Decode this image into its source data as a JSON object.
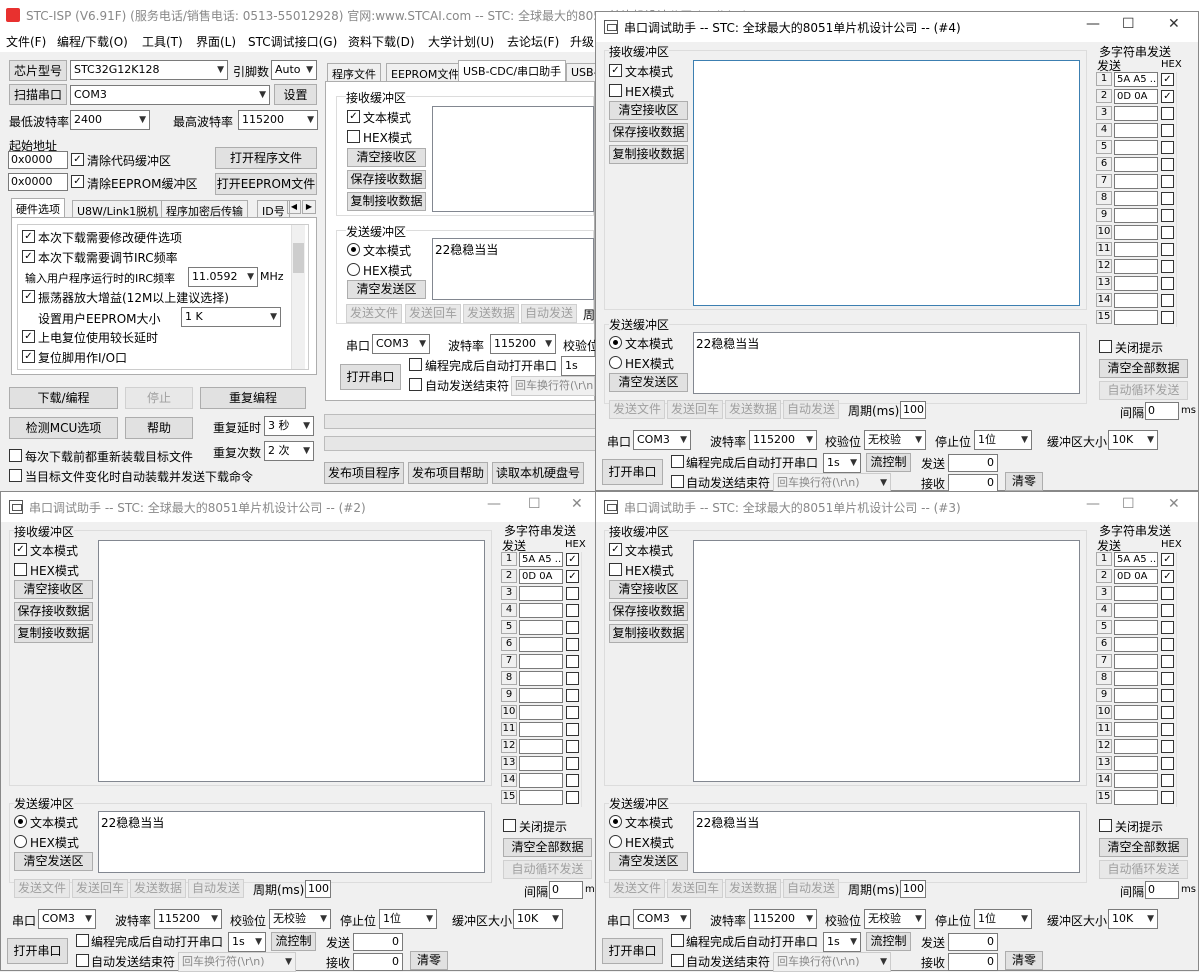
{
  "main": {
    "title": "STC-ISP (V6.91F) (服务电话/销售电话: 0513-55012928) 官网:www.STCAI.com  -- STC: 全球最大的8051单片机设计公司 (Build...)",
    "menu": [
      "文件(F)",
      "编程/下载(O)",
      "工具(T)",
      "界面(L)",
      "STC调试接口(G)",
      "资料下载(D)",
      "大学计划(U)",
      "去论坛(F)",
      "升级"
    ],
    "chip_label": "芯片型号",
    "chip": "STC32G12K128",
    "pins_label": "引脚数",
    "pins": "Auto",
    "scan_label": "扫描串口",
    "port": "COM3",
    "settings": "设置",
    "min_baud_label": "最低波特率",
    "min_baud": "2400",
    "max_baud_label": "最高波特率",
    "max_baud": "115200",
    "start_addr": "起始地址",
    "addr1": "0x0000",
    "addr2": "0x0000",
    "clear_code": "清除代码缓冲区",
    "clear_eeprom": "清除EEPROM缓冲区",
    "open_prog": "打开程序文件",
    "open_eeprom": "打开EEPROM文件",
    "hw_tabs": [
      "硬件选项",
      "U8W/Link1脱机",
      "程序加密后传输",
      "ID号"
    ],
    "opt1": "本次下载需要修改硬件选项",
    "opt2": "本次下载需要调节IRC频率",
    "irc_label": "输入用户程序运行时的IRC频率",
    "irc": "11.0592",
    "mhz": "MHz",
    "opt3": "振荡器放大增益(12M以上建议选择)",
    "eeprom_label": "设置用户EEPROM大小",
    "eeprom": "1   K",
    "opt4": "上电复位使用较长延时",
    "opt5": "复位脚用作I/O口",
    "download": "下载/编程",
    "stop": "停止",
    "reprogram": "重复编程",
    "check_mcu": "检测MCU选项",
    "help": "帮助",
    "repeat_delay_label": "重复延时",
    "repeat_delay": "3 秒",
    "repeat_count_label": "重复次数",
    "repeat_count": "2 次",
    "reload_each": "每次下载前都重新装载目标文件",
    "auto_reload": "当目标文件变化时自动装载并发送下载命令",
    "right_tabs": [
      "程序文件",
      "EEPROM文件",
      "USB-CDC/串口助手",
      "USB-"
    ],
    "rx_group": "接收缓冲区",
    "text_mode": "文本模式",
    "hex_mode": "HEX模式",
    "clear_rx": "清空接收区",
    "save_rx": "保存接收数据",
    "copy_rx": "复制接收数据",
    "tx_group": "发送缓冲区",
    "tx_text": "22稳稳当当",
    "clear_tx": "清空发送区",
    "send_file": "发送文件",
    "send_enter": "发送回车",
    "send_data": "发送数据",
    "auto_send": "自动发送",
    "period_short": "周",
    "port_label": "串口",
    "baud_label": "波特率",
    "baud": "115200",
    "parity_short": "校验位",
    "open_port": "打开串口",
    "auto_open": "编程完成后自动打开串口",
    "auto_open_time": "1s",
    "auto_end": "自动发送结束符",
    "newline": "回车换行符(\\r\\n)",
    "publish_prog": "发布项目程序",
    "publish_help": "发布项目帮助",
    "read_disk": "读取本机硬盘号"
  },
  "serial": {
    "title4": "串口调试助手 -- STC: 全球最大的8051单片机设计公司 -- (#4)",
    "title2": "串口调试助手 -- STC: 全球最大的8051单片机设计公司 -- (#2)",
    "title3": "串口调试助手 -- STC: 全球最大的8051单片机设计公司 -- (#3)",
    "rx_group": "接收缓冲区",
    "text_mode": "文本模式",
    "hex_mode": "HEX模式",
    "clear_rx": "清空接收区",
    "save_rx": "保存接收数据",
    "copy_rx": "复制接收数据",
    "multi_title": "多字符串发送",
    "send_col": "发送",
    "hex_col": "HEX",
    "row1": "5A A5 ...",
    "row2": "0D 0A",
    "rows": [
      "1",
      "2",
      "3",
      "4",
      "5",
      "6",
      "7",
      "8",
      "9",
      "10",
      "11",
      "12",
      "13",
      "14",
      "15"
    ],
    "tx_group": "发送缓冲区",
    "tx_text": "22稳稳当当",
    "clear_tx": "清空发送区",
    "close_hint": "关闭提示",
    "clear_all": "清空全部数据",
    "auto_loop": "自动循环发送",
    "interval_label": "间隔",
    "interval": "0",
    "ms": "ms",
    "send_file": "发送文件",
    "send_enter": "发送回车",
    "send_data": "发送数据",
    "auto_send": "自动发送",
    "period_label": "周期(ms)",
    "period": "100",
    "port_label": "串口",
    "port": "COM3",
    "baud_label": "波特率",
    "baud": "115200",
    "parity_label": "校验位",
    "parity": "无校验",
    "stop_label": "停止位",
    "stop": "1位",
    "bufsize_label": "缓冲区大小",
    "bufsize": "10K",
    "open_port": "打开串口",
    "auto_open": "编程完成后自动打开串口",
    "auto_open_time": "1s",
    "flow": "流控制",
    "auto_end": "自动发送结束符",
    "newline": "回车换行符(\\r\\n)",
    "tx_count_label": "发送",
    "tx_count": "0",
    "rx_count_label": "接收",
    "rx_count": "0",
    "zero": "清零"
  }
}
